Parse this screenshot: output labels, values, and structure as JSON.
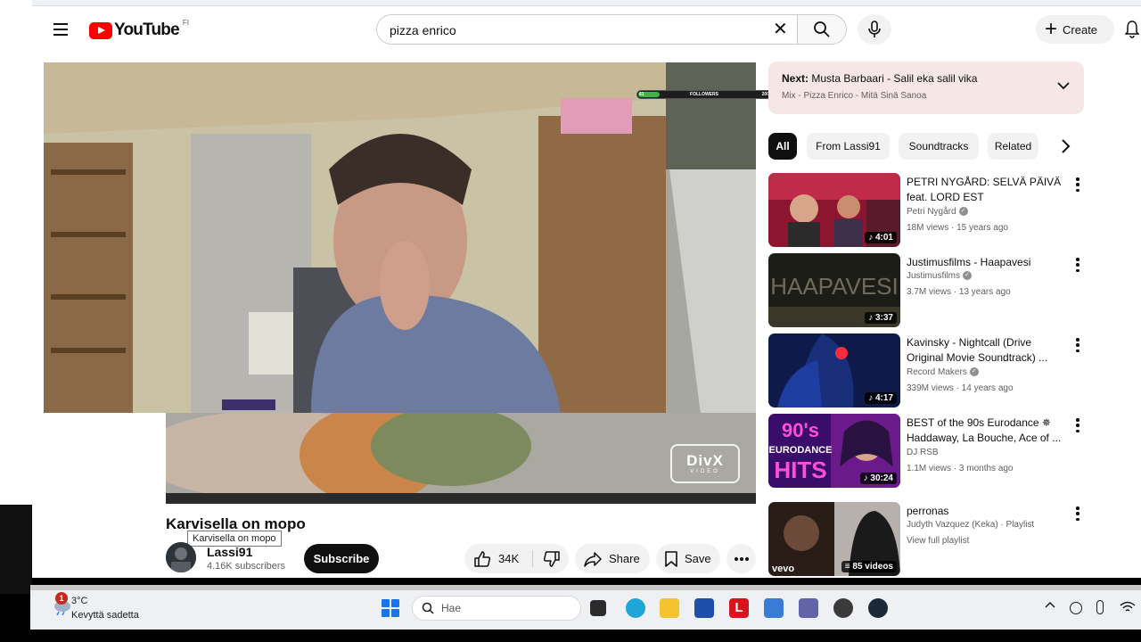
{
  "masthead": {
    "logo_word": "YouTube",
    "country_code": "FI",
    "search_value": "pizza enrico",
    "create_label": "Create"
  },
  "player": {
    "overlay_followers": "FOLLOWERS",
    "overlay_left": "61",
    "overlay_right": "200",
    "divx_text": "DivX",
    "divx_sub": "VIDEO"
  },
  "video": {
    "title": "Karvisella on mopo",
    "tooltip": "Karvisella on mopo",
    "channel": "Lassi91",
    "subscribers": "4.16K subscribers",
    "subscribe_label": "Subscribe",
    "likes": "34K",
    "share_label": "Share",
    "save_label": "Save"
  },
  "next_up": {
    "prefix": "Next:",
    "title": "Musta Barbaari - Salil eka salil vika",
    "subtitle": "Mix - Pizza Enrico - Mitä Sinä Sanoa"
  },
  "chips": [
    "All",
    "From Lassi91",
    "Soundtracks",
    "Related"
  ],
  "recommendations": [
    {
      "title": "PETRI NYGÅRD: SELVÄ PÄIVÄ feat. LORD EST",
      "channel": "Petri Nygård",
      "verified": true,
      "meta": "18M views · 15 years ago",
      "duration": "♪ 4:01"
    },
    {
      "title": "Justimusfilms - Haapavesi",
      "channel": "Justimusfilms",
      "verified": true,
      "meta": "3.7M views · 13 years ago",
      "duration": "♪ 3:37"
    },
    {
      "title": "Kavinsky - Nightcall (Drive Original Movie Soundtrack) ...",
      "channel": "Record Makers",
      "verified": true,
      "meta": "339M views · 14 years ago",
      "duration": "♪ 4:17"
    },
    {
      "title": "BEST of the 90s Eurodance ✵ Haddaway, La Bouche, Ace of ...",
      "channel": "DJ RSB",
      "verified": false,
      "meta": "1.1M views · 3 months ago",
      "duration": "♪ 30:24"
    },
    {
      "title": "perronas",
      "channel": "Judyth Vazquez (Keka) · Playlist",
      "verified": false,
      "meta": "View full playlist",
      "duration": "≡ 85 videos"
    }
  ],
  "thumb_text": {
    "haapavesi": "HAAPAVESI",
    "eurodance_1": "90's",
    "eurodance_2": "EURODANCE",
    "eurodance_3": "HITS",
    "vevo": "vevo"
  },
  "taskbar": {
    "weather_badge": "1",
    "temp": "3°C",
    "weather_desc": "Kevyttä sadetta",
    "search_placeholder": "Hae",
    "l_app": "L"
  },
  "colors": {
    "youtube_red": "#ff0000",
    "next_card_bg": "#f6e6e6",
    "chip_bg": "#f2f2f2"
  }
}
